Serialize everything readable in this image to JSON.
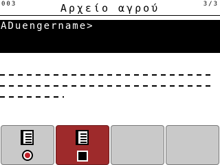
{
  "header": {
    "counter_left": "003",
    "title": "Αρχείο αγρού",
    "counter_right": "3/3"
  },
  "input": {
    "text": "ADuengername>"
  },
  "colors": {
    "selected_tab": "#9e2a2b",
    "tab": "#c9c9c9",
    "record_dot": "#c0222a"
  },
  "tabs": [
    {
      "icon": "document-icon",
      "action_icon": "record-icon",
      "selected": false
    },
    {
      "icon": "document-icon",
      "action_icon": "stop-icon",
      "selected": true
    },
    {
      "icon": "",
      "selected": false
    },
    {
      "icon": "",
      "selected": false
    }
  ]
}
